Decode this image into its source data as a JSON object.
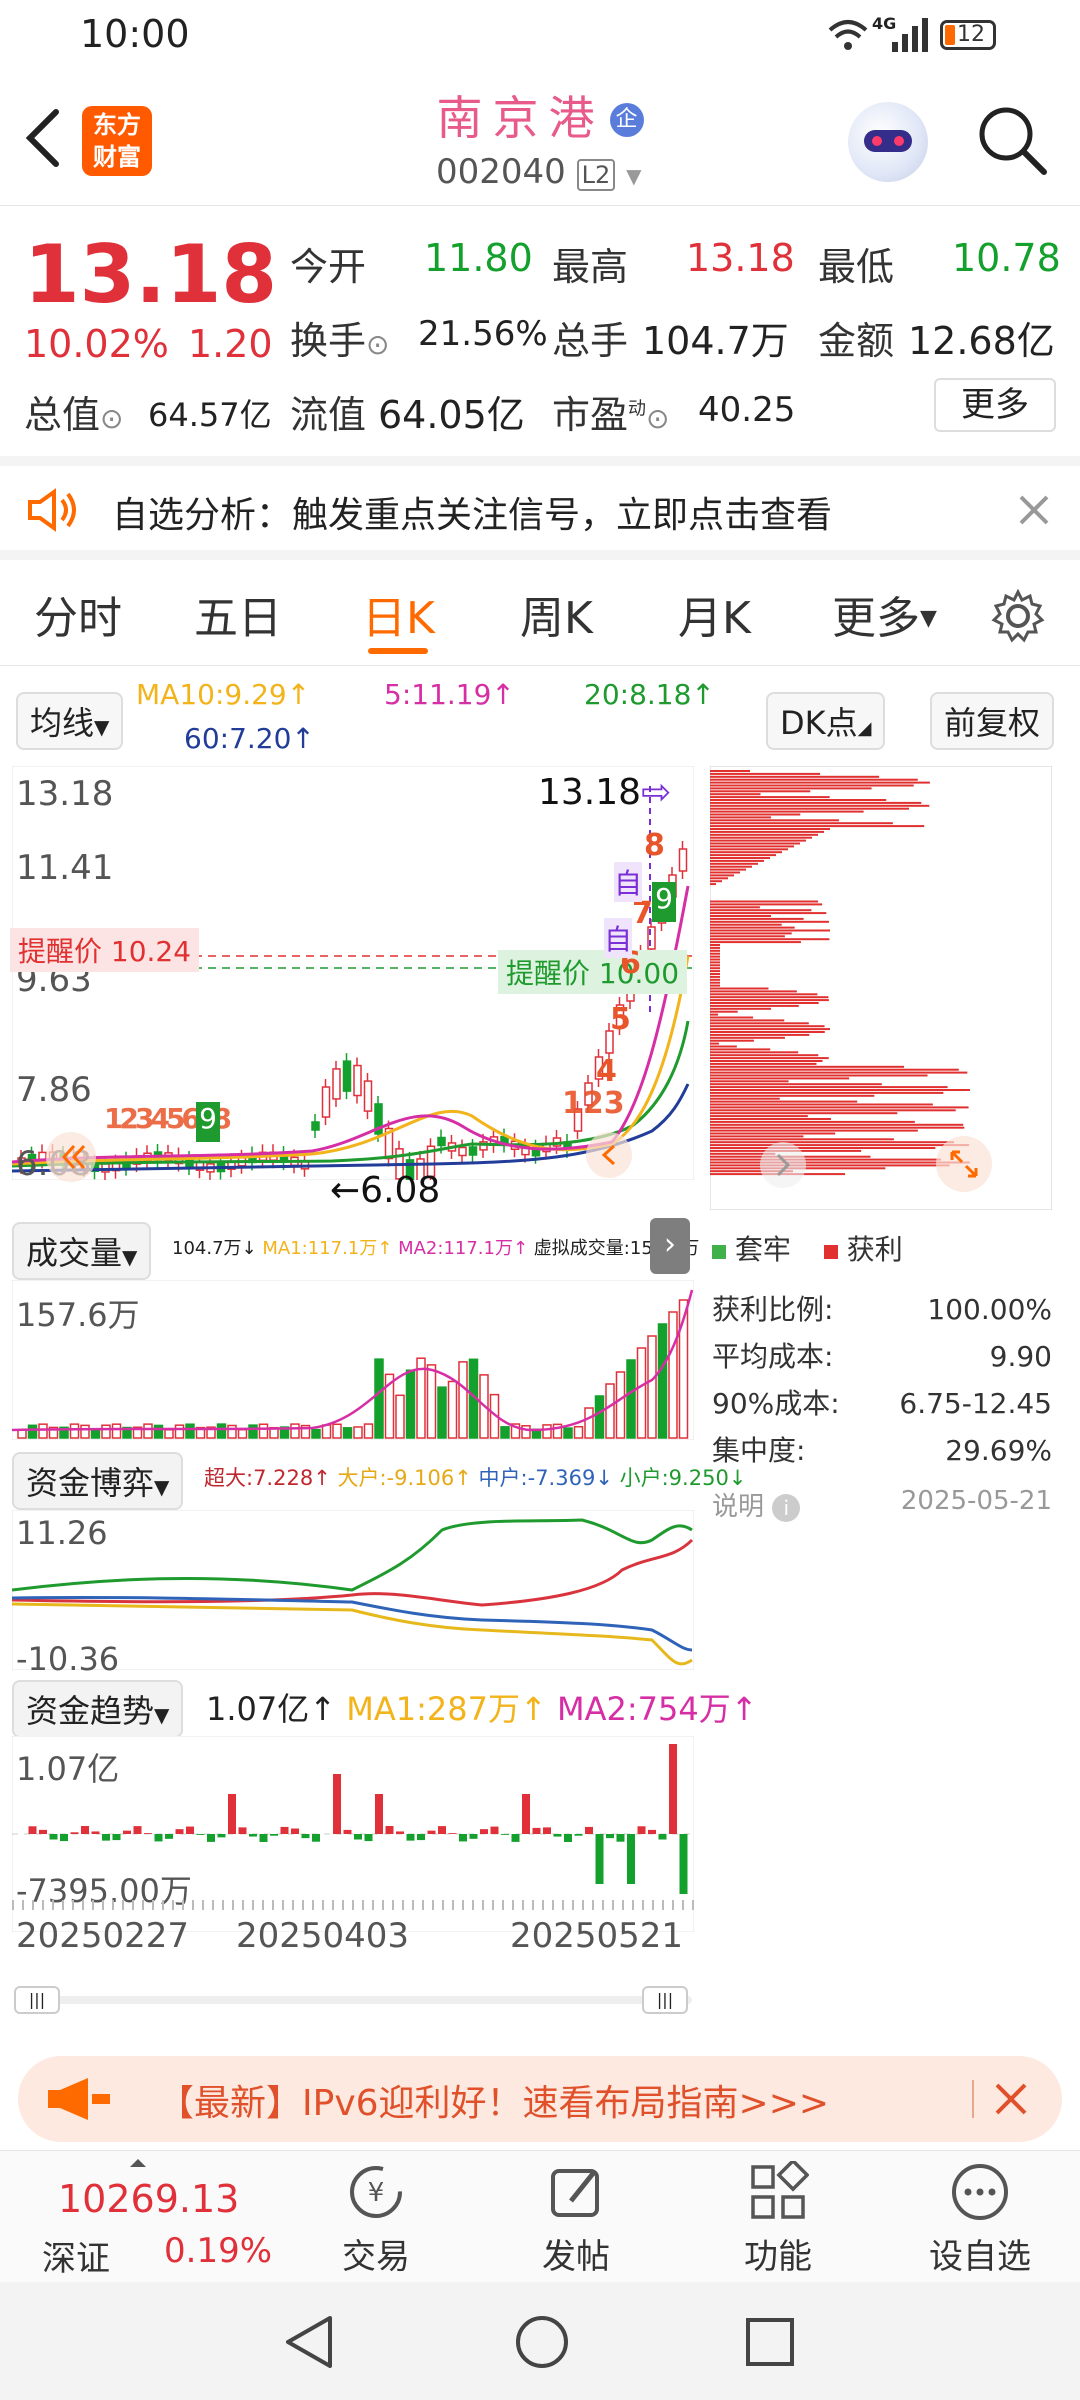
{
  "status_bar": {
    "time": "10:00",
    "network": "4G",
    "battery": "12"
  },
  "header": {
    "logo_line1": "东方",
    "logo_line2": "财富",
    "stock_name": "南京港",
    "badge": "企",
    "code": "002040",
    "level": "L2"
  },
  "quote": {
    "price": "13.18",
    "change_pct": "10.02%",
    "change": "1.20",
    "open_label": "今开",
    "open": "11.80",
    "high_label": "最高",
    "high": "13.18",
    "low_label": "最低",
    "low": "10.78",
    "turnover_label": "换手",
    "turnover": "21.56%",
    "volume_label": "总手",
    "volume": "104.7万",
    "amount_label": "金额",
    "amount": "12.68亿",
    "mcap_label": "总值",
    "mcap": "64.57亿",
    "float_label": "流值",
    "float": "64.05亿",
    "pe_label": "市盈",
    "pe_sup": "动",
    "pe": "40.25",
    "more": "更多"
  },
  "alert_banner": {
    "text": "自选分析：触发重点关注信号，立即点击查看"
  },
  "tabs": [
    "分时",
    "五日",
    "日K",
    "周K",
    "月K",
    "更多"
  ],
  "active_tab": "日K",
  "ma_bar": {
    "selector": "均线",
    "ma10": "MA10:9.29↑",
    "ma5": "5:11.19↑",
    "ma20": "20:8.18↑",
    "ma60": "60:7.20↑",
    "dk": "DK点",
    "adjust": "前复权"
  },
  "kline": {
    "y_labels": [
      "13.18",
      "11.41",
      "9.63",
      "7.86",
      "6.08"
    ],
    "last_price": "13.18",
    "low_marker": "6.08",
    "alert_red": "提醒价 10.24",
    "alert_green": "提醒价 10.00",
    "signal_nums_left": [
      "1",
      "2",
      "3",
      "4",
      "5",
      "6",
      "7",
      "8"
    ],
    "signal_9_left": "9",
    "signal_nums_right": [
      "1",
      "2",
      "3",
      "4",
      "5",
      "6",
      "7",
      "8"
    ],
    "signal_9_right": "9",
    "zi": "自"
  },
  "chip": {
    "legend_trapped": "套牢",
    "legend_profit": "获利",
    "rows": [
      {
        "label": "获利比例:",
        "value": "100.00%"
      },
      {
        "label": "平均成本:",
        "value": "9.90"
      },
      {
        "label": "90%成本:",
        "value": "6.75-12.45"
      },
      {
        "label": "集中度:",
        "value": "29.69%"
      }
    ],
    "note": "说明",
    "date": "2025-05-21"
  },
  "volume_panel": {
    "selector": "成交量",
    "info": "104.7万↓",
    "ma1": "MA1:117.1万↑",
    "ma2": "MA2:117.1万↑",
    "virtual": "虚拟成交量:157.6万",
    "top": "157.6万"
  },
  "fund_game": {
    "selector": "资金博弈",
    "super": "超大:7.228↑",
    "big": "大户:-9.106↑",
    "mid": "中户:-7.369↓",
    "small": "小户:9.250↓",
    "top": "11.26",
    "bottom": "-10.36"
  },
  "fund_trend": {
    "selector": "资金趋势",
    "value": "1.07亿↑",
    "ma1": "MA1:287万↑",
    "ma2": "MA2:754万↑",
    "top": "1.07亿",
    "bottom": "-7395.00万"
  },
  "dates": [
    "20250227",
    "20250403",
    "20250521"
  ],
  "promo": {
    "text": "【最新】IPv6迎利好！速看布局指南>>>"
  },
  "bottom_nav": {
    "index_value": "10269.13",
    "index_name": "深证",
    "index_pct": "0.19%",
    "trade": "交易",
    "post": "发帖",
    "func": "功能",
    "watch": "设自选"
  },
  "colors": {
    "red": "#e0303a",
    "green": "#14a02c",
    "brand": "#ff6a00",
    "ma5": "#d62fa6",
    "ma10": "#f2b31b",
    "ma20": "#1f9a2e",
    "ma60": "#223d99"
  }
}
